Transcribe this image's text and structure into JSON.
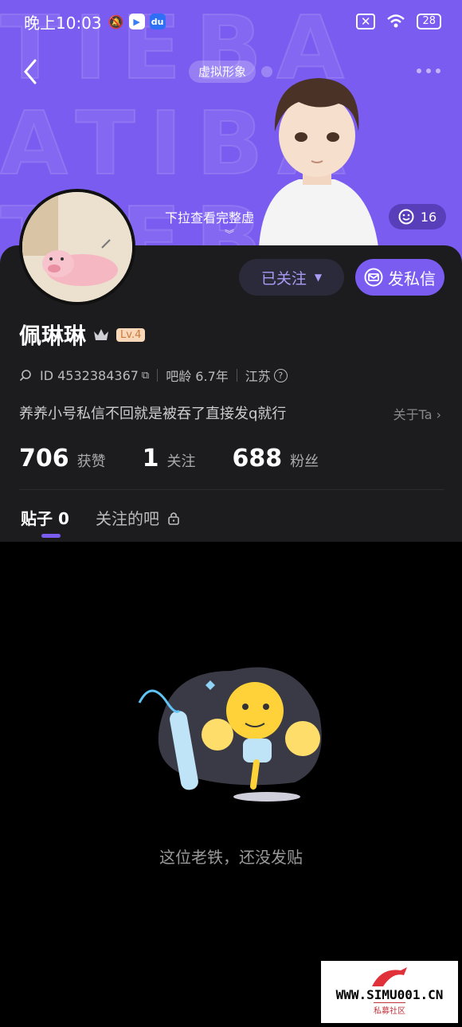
{
  "status_bar": {
    "time": "晚上10:03",
    "battery": "28"
  },
  "header": {
    "avatar_tag": "虚拟形象",
    "pull_hint": "下拉查看完整虚",
    "like_count": "16"
  },
  "profile": {
    "name": "佩琳琳",
    "level": "Lv.4",
    "id_label": "ID 4532384367",
    "bar_age": "吧龄 6.7年",
    "location": "江苏",
    "bio": "养养小号私信不回就是被吞了直接发q就行",
    "about_label": "关于Ta",
    "follow_label": "已关注",
    "message_label": "发私信"
  },
  "stats": [
    {
      "value": "706",
      "label": "获赞"
    },
    {
      "value": "1",
      "label": "关注"
    },
    {
      "value": "688",
      "label": "粉丝"
    }
  ],
  "tabs": {
    "posts": "贴子 0",
    "bars": "关注的吧"
  },
  "empty_state": {
    "text": "这位老铁，还没发贴"
  },
  "watermark": {
    "url": "WWW.SIMU001.CN",
    "caption": "私募社区"
  },
  "colors": {
    "accent": "#7a5cf0",
    "card_bg": "#1c1c1e",
    "level_badge": "#f8d8b8"
  }
}
